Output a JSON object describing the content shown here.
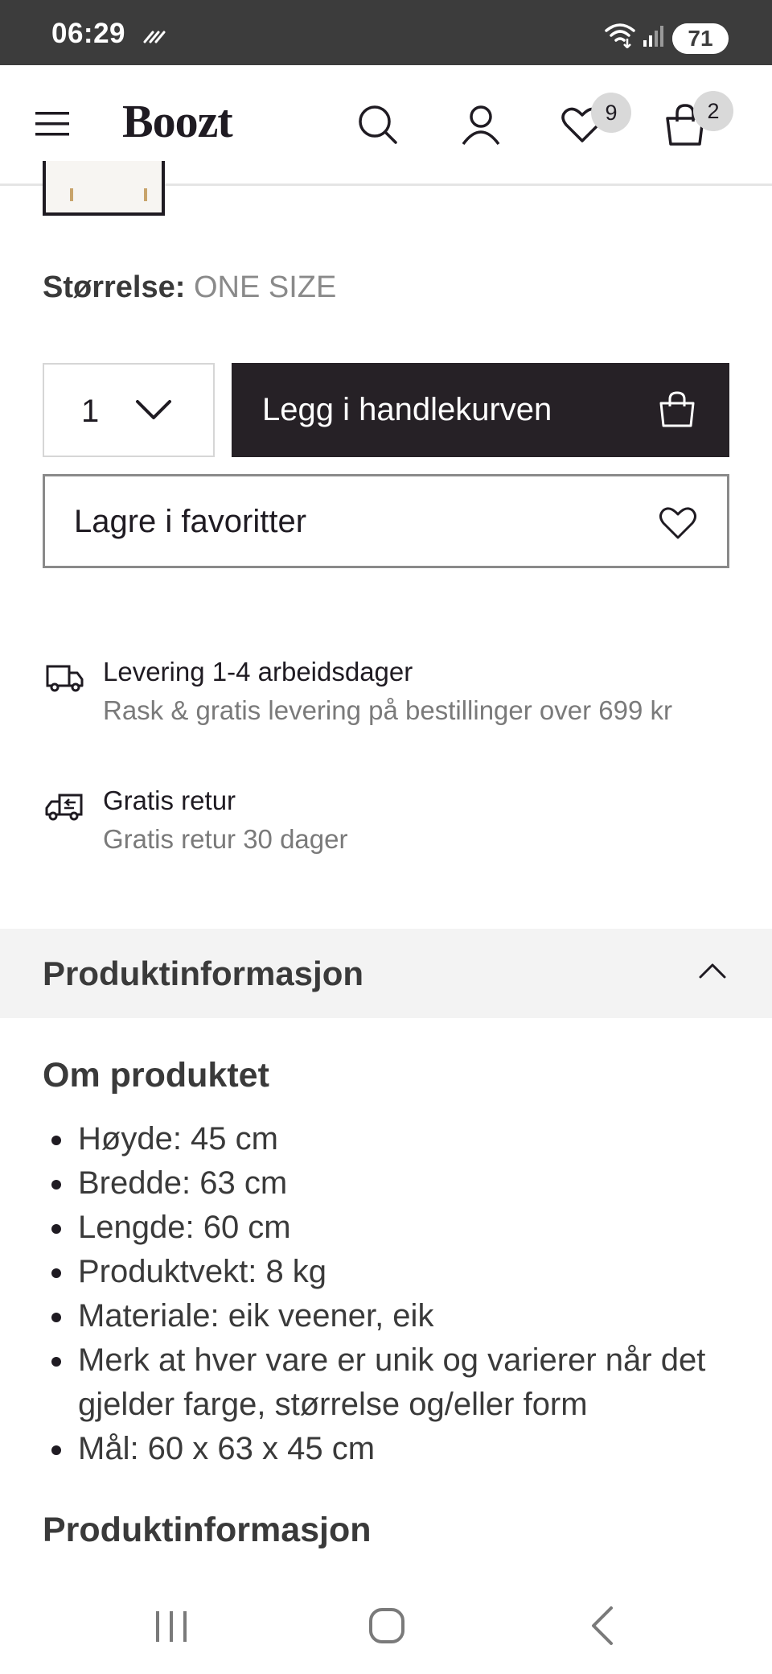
{
  "status_bar": {
    "time": "06:29",
    "battery": "71",
    "battery_level_percent": 71,
    "icons": [
      "data-activity-icon",
      "wifi-icon",
      "cellular-signal-icon",
      "battery-icon"
    ]
  },
  "header": {
    "brand": "Boozt",
    "wishlist_count": "9",
    "cart_count": "2",
    "icons": [
      "menu-icon",
      "search-icon",
      "account-icon",
      "heart-icon",
      "shopping-bag-icon"
    ]
  },
  "product": {
    "size_label": "Størrelse:",
    "size_value": "ONE SIZE",
    "quantity": "1",
    "add_to_cart": "Legg i handlekurven",
    "save_favorites": "Lagre i favoritter"
  },
  "info": {
    "delivery_title": "Levering 1-4 arbeidsdager",
    "delivery_sub": "Rask & gratis levering på bestillinger over 699 kr",
    "return_title": "Gratis retur",
    "return_sub": "Gratis retur 30 dager"
  },
  "product_info": {
    "accordion_title": "Produktinformasjon",
    "about_title": "Om produktet",
    "specs": [
      "Høyde: 45 cm",
      "Bredde: 63 cm",
      "Lengde: 60 cm",
      "Produktvekt: 8 kg",
      "Materiale: eik veener, eik",
      "Merk at hver vare er unik og varierer når det gjelder farge, størrelse og/eller form",
      "Mål: 60 x 63 x 45 cm"
    ],
    "next_section_title": "Produktinformasjon"
  },
  "colors": {
    "status_bar": "#3c3c3c",
    "primary_button": "#262126",
    "accordion_bg": "#f3f3f3",
    "badge_bg": "#d9d9d9"
  }
}
